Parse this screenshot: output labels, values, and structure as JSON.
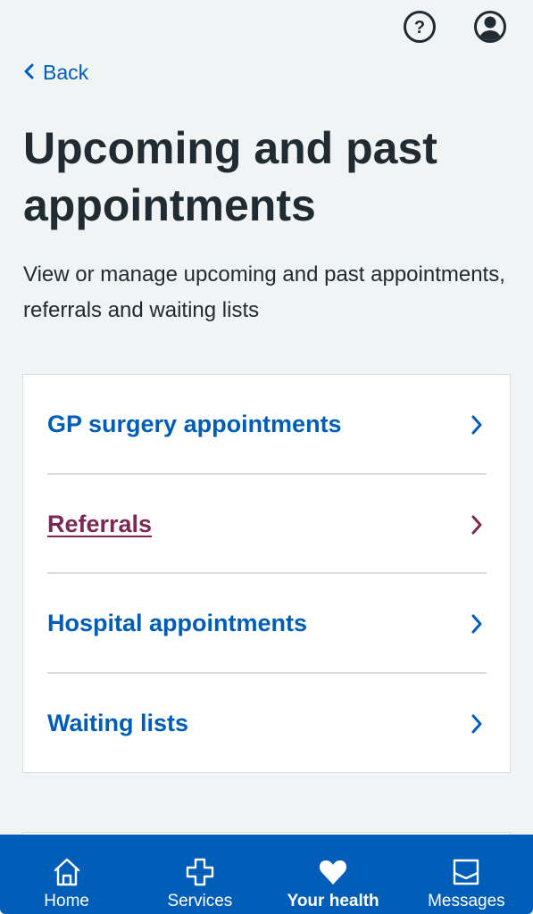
{
  "header": {
    "help_icon": "help-circle-icon",
    "account_icon": "account-circle-icon",
    "back_label": "Back"
  },
  "page": {
    "title": "Upcoming and past appointments",
    "intro": "View or manage upcoming and past appointments, referrals and waiting lists"
  },
  "menu": {
    "items": [
      {
        "label": "GP surgery appointments",
        "visited": false
      },
      {
        "label": "Referrals",
        "visited": true
      },
      {
        "label": "Hospital appointments",
        "visited": false
      },
      {
        "label": "Waiting lists",
        "visited": false
      }
    ]
  },
  "bottom_nav": {
    "items": [
      {
        "label": "Home",
        "icon": "home-icon",
        "active": false
      },
      {
        "label": "Services",
        "icon": "plus-icon",
        "active": false
      },
      {
        "label": "Your health",
        "icon": "heart-icon",
        "active": true
      },
      {
        "label": "Messages",
        "icon": "inbox-icon",
        "active": false
      }
    ]
  },
  "colors": {
    "link": "#005eb8",
    "visited": "#7c2855",
    "text": "#212b32",
    "background": "#f0f4f5",
    "nav_background": "#005eb8"
  }
}
